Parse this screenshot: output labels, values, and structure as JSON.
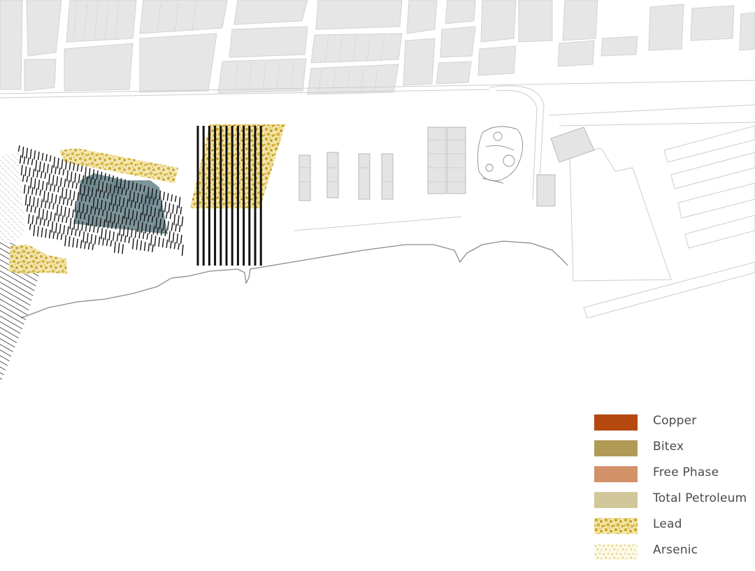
{
  "map": {
    "base_colors": {
      "block_fill": "#e6e6e6",
      "block_stroke": "#d2d2d2",
      "shoreline": "#8a8a8a",
      "outline": "#cccccc",
      "site_hatch": "#111111",
      "contaminant_plume": "#6e8a90"
    }
  },
  "legend": {
    "items": [
      {
        "key": "copper",
        "label": "Copper",
        "color": "#b4480e",
        "pattern": "solid"
      },
      {
        "key": "bitex",
        "label": "Bitex",
        "color": "#b09a55",
        "pattern": "solid"
      },
      {
        "key": "free-phase",
        "label": "Free Phase",
        "color": "#d3916a",
        "pattern": "solid"
      },
      {
        "key": "total-petroleum",
        "label": "Total Petroleum",
        "color": "#d2c79b",
        "pattern": "solid"
      },
      {
        "key": "lead",
        "label": "Lead",
        "color": "#cfae2c",
        "pattern": "dense-speckle"
      },
      {
        "key": "arsenic",
        "label": "Arsenic",
        "color": "#dcc66a",
        "pattern": "light-speckle"
      }
    ]
  }
}
